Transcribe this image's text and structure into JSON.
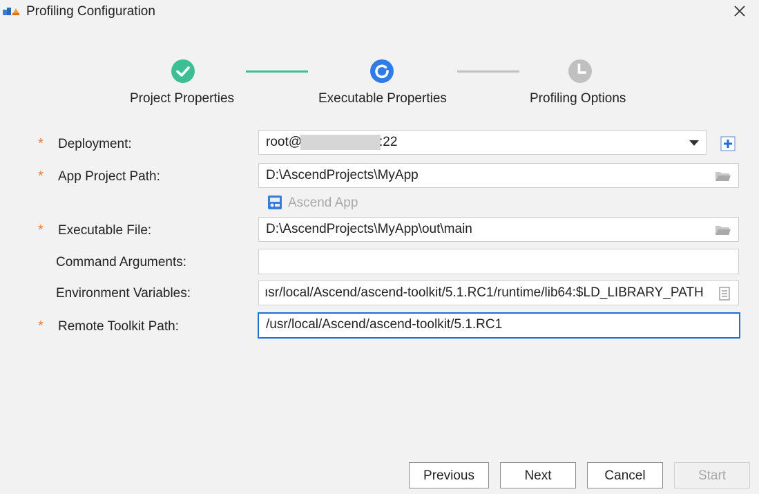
{
  "window": {
    "title": "Profiling Configuration"
  },
  "stepper": {
    "steps": [
      {
        "label": "Project Properties",
        "state": "done"
      },
      {
        "label": "Executable Properties",
        "state": "current"
      },
      {
        "label": "Profiling Options",
        "state": "pending"
      }
    ]
  },
  "form": {
    "required_mark": "*",
    "deployment": {
      "label": "Deployment:",
      "value_prefix": "root@",
      "value_suffix": ":22"
    },
    "app_project_path": {
      "label": "App Project Path:",
      "value": "D:\\AscendProjects\\MyApp"
    },
    "ascend_app": {
      "label": "Ascend App"
    },
    "executable_file": {
      "label": "Executable File:",
      "value": "D:\\AscendProjects\\MyApp\\out\\main"
    },
    "command_arguments": {
      "label": "Command Arguments:",
      "value": ""
    },
    "environment_variables": {
      "label": "Environment Variables:",
      "value": "ısr/local/Ascend/ascend-toolkit/5.1.RC1/runtime/lib64:$LD_LIBRARY_PATH"
    },
    "remote_toolkit_path": {
      "label": "Remote Toolkit Path:",
      "value": "/usr/local/Ascend/ascend-toolkit/5.1.RC1"
    }
  },
  "buttons": {
    "previous": "Previous",
    "next": "Next",
    "cancel": "Cancel",
    "start": "Start"
  },
  "colors": {
    "done": "#3cbf95",
    "current": "#2f7bea",
    "pending": "#c0c0c0",
    "required": "#f07a2b",
    "focus": "#1e6fd6"
  },
  "icons": {
    "app": "app-logo-icon",
    "close": "close-icon",
    "done": "check-circle-icon",
    "current": "refresh-circle-icon",
    "pending": "clock-circle-icon",
    "folder": "folder-icon",
    "document": "document-icon",
    "add": "plus-square-icon",
    "ascend_app": "ascend-app-icon",
    "dropdown": "chevron-down-icon"
  }
}
